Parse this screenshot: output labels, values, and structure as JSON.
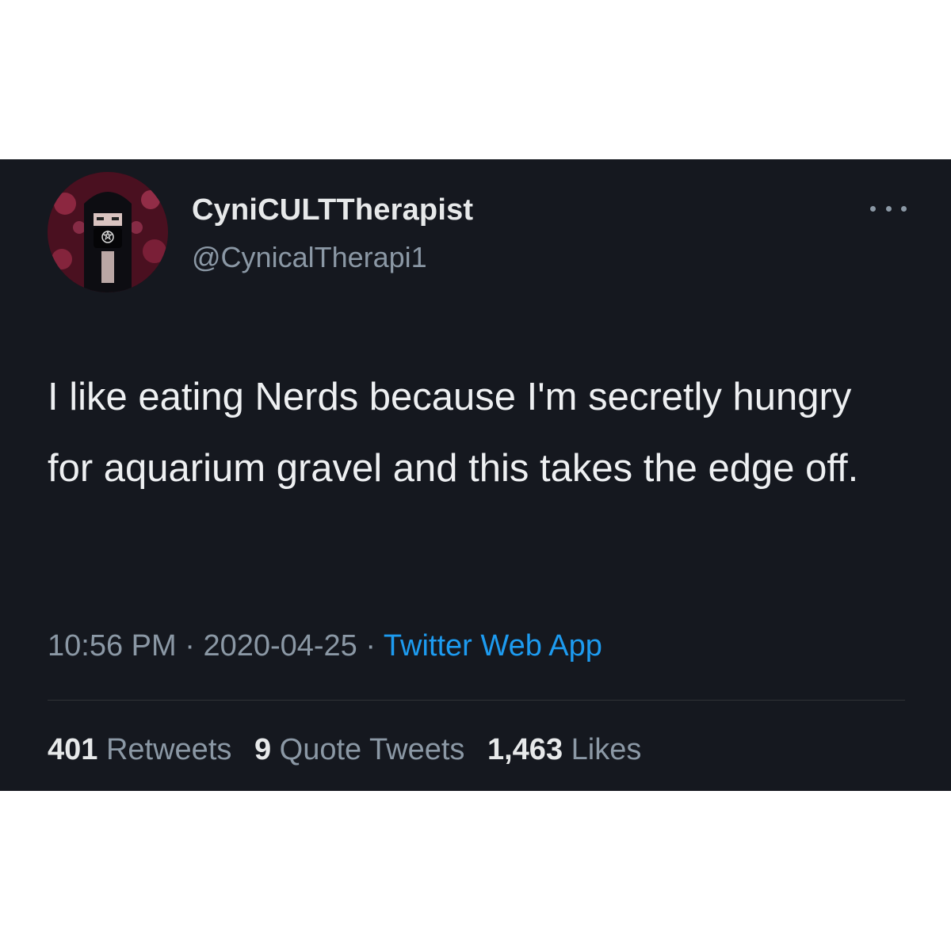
{
  "author": {
    "display_name": "CyniCULTTherapist",
    "handle": "@CynicalTherapi1",
    "avatar_icon": "profile-photo-masked-person"
  },
  "tweet": {
    "text": "I like eating Nerds because I'm secretly hungry for aquarium gravel and this takes the edge off.",
    "time": "10:56 PM",
    "separator": " · ",
    "date": "2020-04-25",
    "source": "Twitter Web App"
  },
  "stats": {
    "retweets_count": "401",
    "retweets_label": "Retweets",
    "quotes_count": "9",
    "quotes_label": "Quote Tweets",
    "likes_count": "1,463",
    "likes_label": "Likes"
  },
  "colors": {
    "background": "#15181f",
    "primary_text": "#e7e9ea",
    "secondary_text": "#8b98a5",
    "link": "#1d9bf0",
    "page_background": "#ffffff"
  },
  "icons": {
    "more": "more-horizontal-icon"
  }
}
